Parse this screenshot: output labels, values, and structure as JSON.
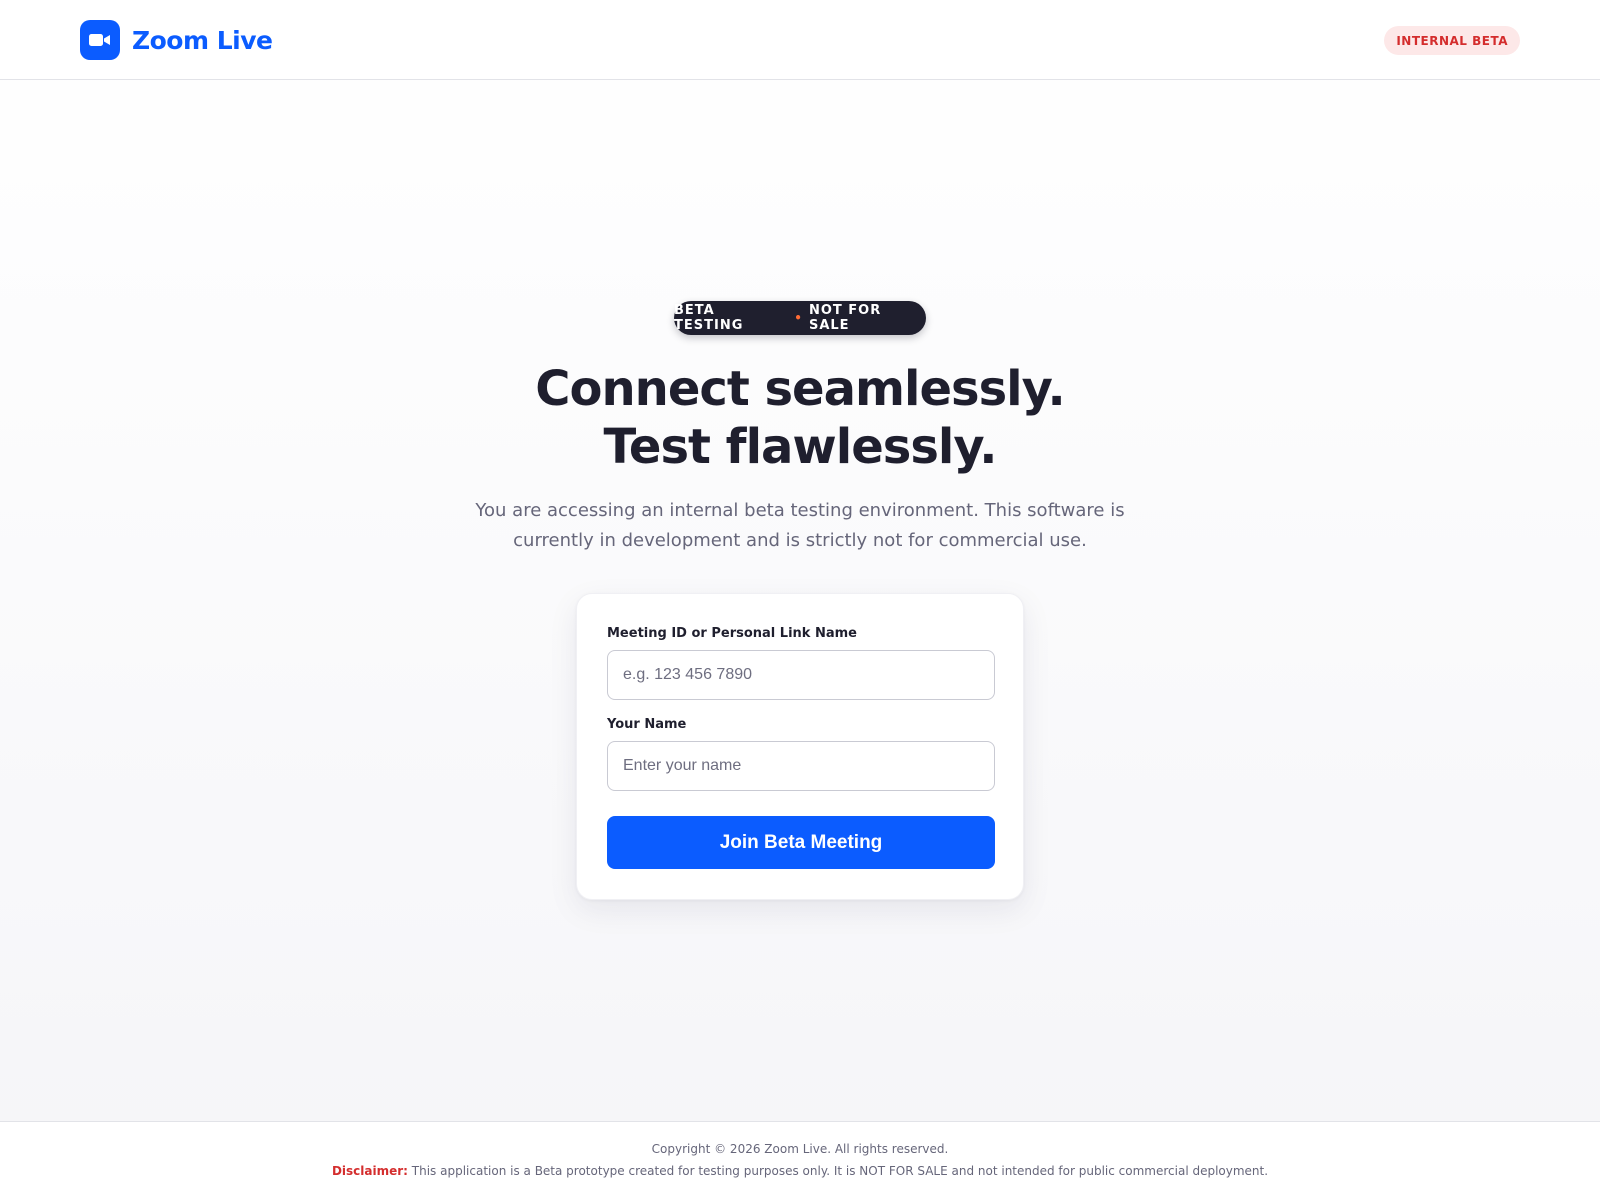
{
  "header": {
    "brand": "Zoom Live",
    "logo_icon": "video-camera-icon",
    "badge": "INTERNAL BETA"
  },
  "hero": {
    "pill_left": "BETA TESTING",
    "pill_separator": "•",
    "pill_right": "NOT FOR SALE",
    "headline_line1": "Connect seamlessly.",
    "headline_line2": "Test flawlessly.",
    "subtitle_line1": "You are accessing an internal beta testing environment. This software is",
    "subtitle_line2": "currently in development and is strictly not for commercial use."
  },
  "form": {
    "meeting_label": "Meeting ID or Personal Link Name",
    "meeting_placeholder": "e.g. 123 456 7890",
    "meeting_value": "",
    "name_label": "Your Name",
    "name_placeholder": "Enter your name",
    "name_value": "",
    "submit_label": "Join Beta Meeting"
  },
  "footer": {
    "copyright": "Copyright © 2026 Zoom Live. All rights reserved.",
    "disclaimer_label": "Disclaimer:",
    "disclaimer_text": "This application is a Beta prototype created for testing purposes only. It is NOT FOR SALE and not intended for public commercial deployment."
  },
  "colors": {
    "brand_blue": "#0b5cff",
    "dark": "#1f1f2e",
    "danger": "#d42d2d",
    "accent_dot": "#ff6b35"
  }
}
